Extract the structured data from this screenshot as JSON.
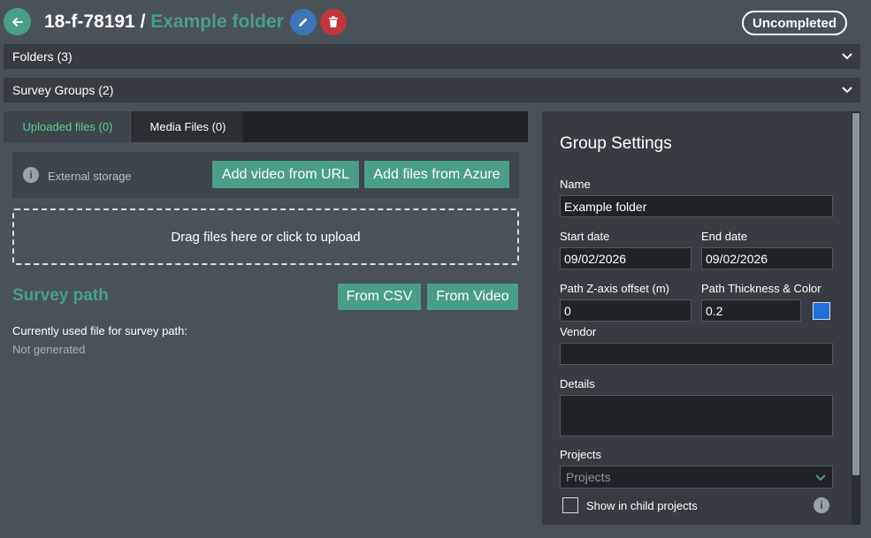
{
  "header": {
    "id": "18-f-78191",
    "separator": " / ",
    "folder_name": "Example folder",
    "status": "Uncompleted"
  },
  "accordions": {
    "folders": "Folders (3)",
    "survey_groups": "Survey Groups (2)"
  },
  "tabs": [
    {
      "label": "Uploaded files (0)",
      "active": true
    },
    {
      "label": "Media Files (0)",
      "active": false
    }
  ],
  "upload": {
    "external_storage_label": "External storage",
    "add_video_url": "Add video from URL",
    "add_files_azure": "Add files from Azure",
    "dropzone_text": "Drag files here or click to upload"
  },
  "survey_path": {
    "title": "Survey path",
    "from_csv": "From CSV",
    "from_video": "From Video",
    "current_file_label": "Currently used file for survey path:",
    "current_file_value": "Not generated"
  },
  "group_settings": {
    "title": "Group Settings",
    "name_label": "Name",
    "name_value": "Example folder",
    "start_date_label": "Start date",
    "start_date_value": "09/02/2026",
    "end_date_label": "End date",
    "end_date_value": "09/02/2026",
    "z_offset_label": "Path Z-axis offset (m)",
    "z_offset_value": "0",
    "thickness_label": "Path Thickness & Color",
    "thickness_value": "0.2",
    "path_color": "#1f6fe0",
    "vendor_label": "Vendor",
    "vendor_value": "",
    "details_label": "Details",
    "projects_label": "Projects",
    "projects_placeholder": "Projects",
    "show_child_label": "Show in child projects"
  },
  "colors": {
    "accent": "#4a9e87",
    "edit": "#3d74b5",
    "delete": "#c0363a",
    "active_tab_text": "#5ed08e"
  }
}
